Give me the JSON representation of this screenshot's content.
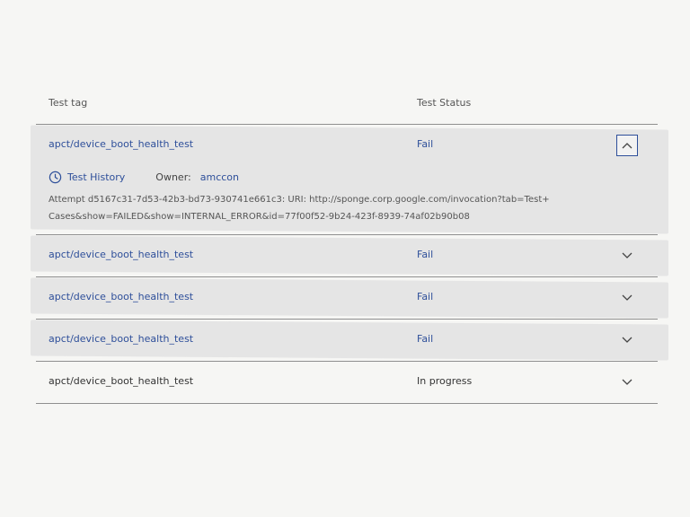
{
  "header": {
    "col_tag": "Test tag",
    "col_status": "Test Status"
  },
  "rows": [
    {
      "tag": "apct/device_boot_health_test",
      "status": "Fail",
      "expanded": true,
      "details": {
        "history_label": "Test History",
        "owner_label": "Owner:",
        "owner": "amccon",
        "attempt": "Attempt d5167c31-7d53-42b3-bd73-930741e661c3: URI: http://sponge.corp.google.com/invocation?tab=Test+Cases&show=FAILED&show=INTERNAL_ERROR&id=77f00f52-9b24-423f-8939-74af02b90b08"
      }
    },
    {
      "tag": "apct/device_boot_health_test",
      "status": "Fail",
      "expanded": false
    },
    {
      "tag": "apct/device_boot_health_test",
      "status": "Fail",
      "expanded": false
    },
    {
      "tag": "apct/device_boot_health_test",
      "status": "Fail",
      "expanded": false
    },
    {
      "tag": "apct/device_boot_health_test",
      "status": "In progress",
      "expanded": false
    }
  ],
  "icons": {
    "expanded_toggle": "chevron-up-icon",
    "collapsed_toggle": "chevron-down-icon",
    "history": "clock-icon"
  },
  "colors": {
    "link": "#2e4f9a",
    "row_shade": "#e5e5e5",
    "divider": "#8f8f8f"
  }
}
